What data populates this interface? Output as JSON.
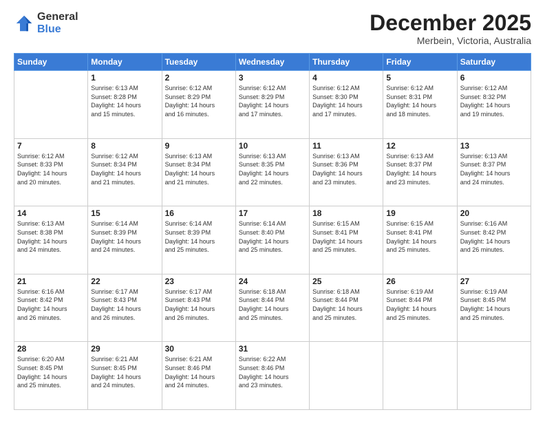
{
  "logo": {
    "general": "General",
    "blue": "Blue"
  },
  "title": "December 2025",
  "subtitle": "Merbein, Victoria, Australia",
  "days_of_week": [
    "Sunday",
    "Monday",
    "Tuesday",
    "Wednesday",
    "Thursday",
    "Friday",
    "Saturday"
  ],
  "weeks": [
    [
      {
        "day": "",
        "info": ""
      },
      {
        "day": "1",
        "info": "Sunrise: 6:13 AM\nSunset: 8:28 PM\nDaylight: 14 hours\nand 15 minutes."
      },
      {
        "day": "2",
        "info": "Sunrise: 6:12 AM\nSunset: 8:29 PM\nDaylight: 14 hours\nand 16 minutes."
      },
      {
        "day": "3",
        "info": "Sunrise: 6:12 AM\nSunset: 8:29 PM\nDaylight: 14 hours\nand 17 minutes."
      },
      {
        "day": "4",
        "info": "Sunrise: 6:12 AM\nSunset: 8:30 PM\nDaylight: 14 hours\nand 17 minutes."
      },
      {
        "day": "5",
        "info": "Sunrise: 6:12 AM\nSunset: 8:31 PM\nDaylight: 14 hours\nand 18 minutes."
      },
      {
        "day": "6",
        "info": "Sunrise: 6:12 AM\nSunset: 8:32 PM\nDaylight: 14 hours\nand 19 minutes."
      }
    ],
    [
      {
        "day": "7",
        "info": "Sunrise: 6:12 AM\nSunset: 8:33 PM\nDaylight: 14 hours\nand 20 minutes."
      },
      {
        "day": "8",
        "info": "Sunrise: 6:12 AM\nSunset: 8:34 PM\nDaylight: 14 hours\nand 21 minutes."
      },
      {
        "day": "9",
        "info": "Sunrise: 6:13 AM\nSunset: 8:34 PM\nDaylight: 14 hours\nand 21 minutes."
      },
      {
        "day": "10",
        "info": "Sunrise: 6:13 AM\nSunset: 8:35 PM\nDaylight: 14 hours\nand 22 minutes."
      },
      {
        "day": "11",
        "info": "Sunrise: 6:13 AM\nSunset: 8:36 PM\nDaylight: 14 hours\nand 23 minutes."
      },
      {
        "day": "12",
        "info": "Sunrise: 6:13 AM\nSunset: 8:37 PM\nDaylight: 14 hours\nand 23 minutes."
      },
      {
        "day": "13",
        "info": "Sunrise: 6:13 AM\nSunset: 8:37 PM\nDaylight: 14 hours\nand 24 minutes."
      }
    ],
    [
      {
        "day": "14",
        "info": "Sunrise: 6:13 AM\nSunset: 8:38 PM\nDaylight: 14 hours\nand 24 minutes."
      },
      {
        "day": "15",
        "info": "Sunrise: 6:14 AM\nSunset: 8:39 PM\nDaylight: 14 hours\nand 24 minutes."
      },
      {
        "day": "16",
        "info": "Sunrise: 6:14 AM\nSunset: 8:39 PM\nDaylight: 14 hours\nand 25 minutes."
      },
      {
        "day": "17",
        "info": "Sunrise: 6:14 AM\nSunset: 8:40 PM\nDaylight: 14 hours\nand 25 minutes."
      },
      {
        "day": "18",
        "info": "Sunrise: 6:15 AM\nSunset: 8:41 PM\nDaylight: 14 hours\nand 25 minutes."
      },
      {
        "day": "19",
        "info": "Sunrise: 6:15 AM\nSunset: 8:41 PM\nDaylight: 14 hours\nand 25 minutes."
      },
      {
        "day": "20",
        "info": "Sunrise: 6:16 AM\nSunset: 8:42 PM\nDaylight: 14 hours\nand 26 minutes."
      }
    ],
    [
      {
        "day": "21",
        "info": "Sunrise: 6:16 AM\nSunset: 8:42 PM\nDaylight: 14 hours\nand 26 minutes."
      },
      {
        "day": "22",
        "info": "Sunrise: 6:17 AM\nSunset: 8:43 PM\nDaylight: 14 hours\nand 26 minutes."
      },
      {
        "day": "23",
        "info": "Sunrise: 6:17 AM\nSunset: 8:43 PM\nDaylight: 14 hours\nand 26 minutes."
      },
      {
        "day": "24",
        "info": "Sunrise: 6:18 AM\nSunset: 8:44 PM\nDaylight: 14 hours\nand 25 minutes."
      },
      {
        "day": "25",
        "info": "Sunrise: 6:18 AM\nSunset: 8:44 PM\nDaylight: 14 hours\nand 25 minutes."
      },
      {
        "day": "26",
        "info": "Sunrise: 6:19 AM\nSunset: 8:44 PM\nDaylight: 14 hours\nand 25 minutes."
      },
      {
        "day": "27",
        "info": "Sunrise: 6:19 AM\nSunset: 8:45 PM\nDaylight: 14 hours\nand 25 minutes."
      }
    ],
    [
      {
        "day": "28",
        "info": "Sunrise: 6:20 AM\nSunset: 8:45 PM\nDaylight: 14 hours\nand 25 minutes."
      },
      {
        "day": "29",
        "info": "Sunrise: 6:21 AM\nSunset: 8:45 PM\nDaylight: 14 hours\nand 24 minutes."
      },
      {
        "day": "30",
        "info": "Sunrise: 6:21 AM\nSunset: 8:46 PM\nDaylight: 14 hours\nand 24 minutes."
      },
      {
        "day": "31",
        "info": "Sunrise: 6:22 AM\nSunset: 8:46 PM\nDaylight: 14 hours\nand 23 minutes."
      },
      {
        "day": "",
        "info": ""
      },
      {
        "day": "",
        "info": ""
      },
      {
        "day": "",
        "info": ""
      }
    ]
  ]
}
